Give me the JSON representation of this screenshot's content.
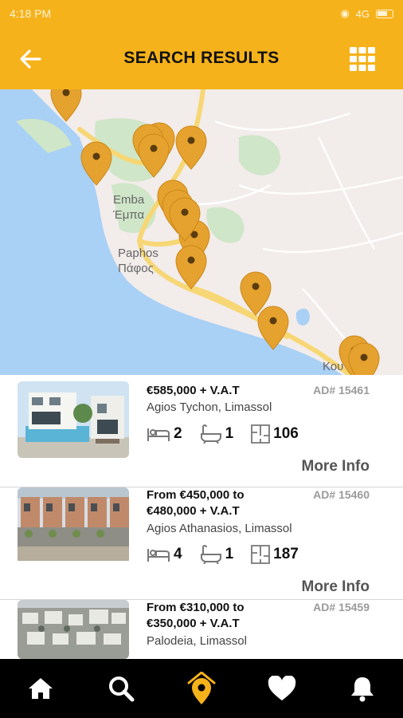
{
  "status_bar": {
    "time": "4:18 PM",
    "network": "4G"
  },
  "app_bar": {
    "title": "SEARCH RESULTS",
    "back_icon": "arrow-left-icon",
    "view_icon": "grid-view-icon"
  },
  "map": {
    "labels": [
      {
        "text": "Emba"
      },
      {
        "text": "Έμπα"
      },
      {
        "text": "Paphos"
      },
      {
        "text": "Πάφος"
      },
      {
        "text": "Κου"
      }
    ],
    "marker_color": "#e6a22e",
    "marker_count": 15
  },
  "listings": [
    {
      "price": "€585,000 + V.A.T",
      "price_line2": "",
      "ad": "AD# 15461",
      "location": "Agios Tychon, Limassol",
      "beds": "2",
      "baths": "1",
      "area": "106",
      "more": "More Info"
    },
    {
      "price": "From €450,000 to",
      "price_line2": "€480,000 + V.A.T",
      "ad": "AD# 15460",
      "location": "Agios Athanasios, Limassol",
      "beds": "4",
      "baths": "1",
      "area": "187",
      "more": "More Info"
    },
    {
      "price": "From €310,000 to",
      "price_line2": "€350,000 + V.A.T",
      "ad": "AD# 15459",
      "location": "Palodeia, Limassol",
      "beds": "",
      "baths": "",
      "area": "",
      "more": ""
    }
  ],
  "bottom_nav": [
    {
      "icon": "home-icon"
    },
    {
      "icon": "search-icon"
    },
    {
      "icon": "map-marker-icon",
      "active": true
    },
    {
      "icon": "heart-icon"
    },
    {
      "icon": "bell-icon"
    }
  ],
  "colors": {
    "accent": "#f6b21b",
    "active_nav": "#f6b21b",
    "nav_bg": "#000000"
  }
}
